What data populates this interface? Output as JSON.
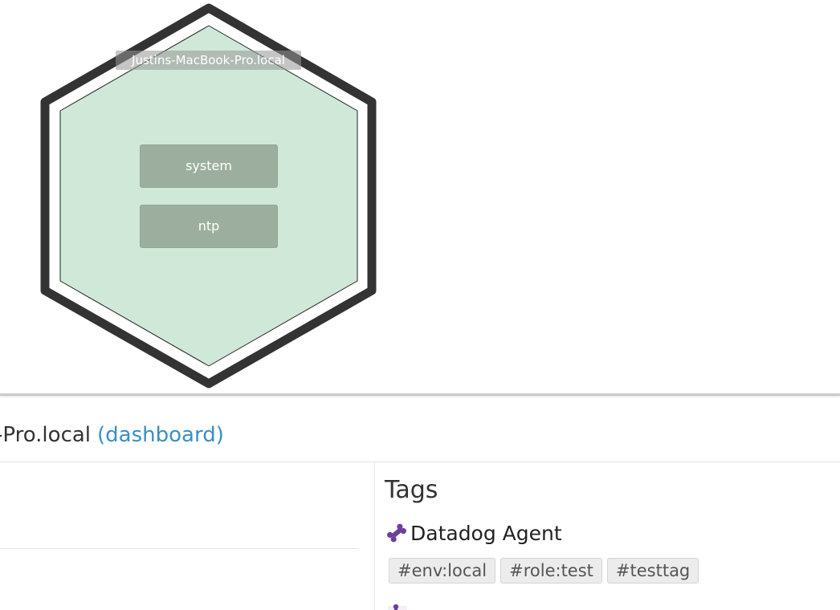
{
  "host_map": {
    "host_label": "Justins-MacBook-Pro.local",
    "checks": [
      {
        "label": "system"
      },
      {
        "label": "ntp"
      }
    ],
    "colors": {
      "hex_border": "#333333",
      "hex_fill": "#cfe8d8",
      "check_fill": "#9caf9f"
    }
  },
  "panel": {
    "title_visible": "-Pro.local",
    "dashboard_link": "(dashboard)",
    "tags_heading": "Tags",
    "source": {
      "name": "Datadog Agent",
      "icon": "bone-icon",
      "icon_color": "#6b3fa0"
    },
    "tags": [
      "#env:local",
      "#role:test",
      "#testtag"
    ]
  }
}
